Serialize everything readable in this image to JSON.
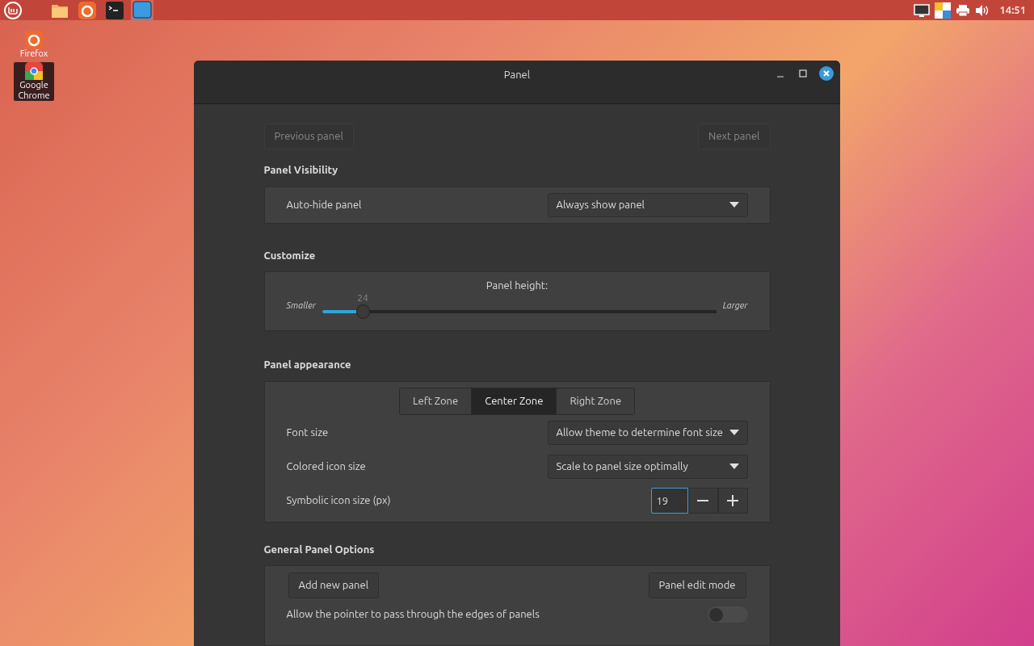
{
  "taskbar": {
    "launchers": [
      {
        "kind": "files",
        "selected": false
      },
      {
        "kind": "firefox",
        "selected": false
      },
      {
        "kind": "terminal",
        "selected": false
      },
      {
        "kind": "window",
        "selected": true
      }
    ],
    "tray": {
      "clock": "14:51"
    }
  },
  "desktop_icons": [
    {
      "kind": "firefox",
      "label": "Firefox",
      "selected": false
    },
    {
      "kind": "chrome",
      "label": "Google Chrome",
      "selected": true
    }
  ],
  "window": {
    "title": "Panel",
    "nav": {
      "previous": {
        "label": "Previous panel",
        "disabled": true
      },
      "next": {
        "label": "Next panel",
        "disabled": true
      }
    },
    "visibility": {
      "title": "Panel Visibility",
      "label": "Auto-hide panel",
      "value": "Always show panel"
    },
    "customize": {
      "title": "Customize",
      "heading": "Panel height:",
      "min_label": "Smaller",
      "max_label": "Larger",
      "reading": "24",
      "level": 0.105
    },
    "appearance": {
      "title": "Panel appearance",
      "zones": [
        {
          "label": "Left Zone",
          "selected": false
        },
        {
          "label": "Center Zone",
          "selected": true
        },
        {
          "label": "Right Zone",
          "selected": false
        }
      ],
      "rows": [
        {
          "kind": "dropdown",
          "label": "Font size",
          "value": "Allow theme to determine font size"
        },
        {
          "kind": "dropdown",
          "label": "Colored icon size",
          "value": "Scale to panel size optimally"
        },
        {
          "kind": "spin",
          "label": "Symbolic icon size (px)",
          "value": "19"
        }
      ]
    },
    "general": {
      "title": "General Panel Options",
      "add": "Add new panel",
      "edit": "Panel edit mode",
      "pointer": {
        "label": "Allow the pointer to pass through the edges of panels",
        "on": false
      }
    }
  }
}
